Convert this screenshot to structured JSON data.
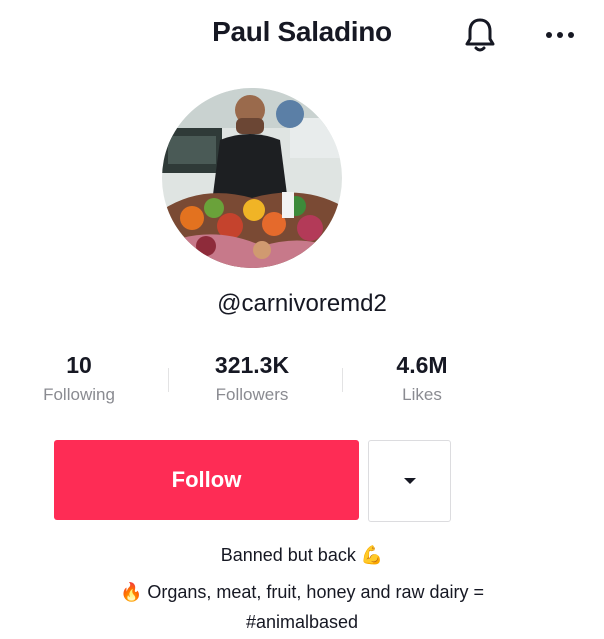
{
  "profile": {
    "name": "Paul Saladino",
    "handle": "@carnivoremd2"
  },
  "header": {
    "bell_icon": "bell-icon",
    "more_icon": "more-horizontal-icon"
  },
  "stats": [
    {
      "value": "10",
      "label": "Following"
    },
    {
      "value": "321.3K",
      "label": "Followers"
    },
    {
      "value": "4.6M",
      "label": "Likes"
    }
  ],
  "actions": {
    "follow_label": "Follow",
    "dropdown_icon": "caret-down-icon"
  },
  "bio": {
    "line1": "Banned but back",
    "line1_emoji": "💪",
    "line2_emoji": "🔥",
    "line2": "Organs, meat, fruit, honey and raw dairy =",
    "line3": "#animalbased"
  },
  "colors": {
    "accent": "#fe2c55",
    "text": "#161823",
    "muted": "#8a8b91"
  }
}
